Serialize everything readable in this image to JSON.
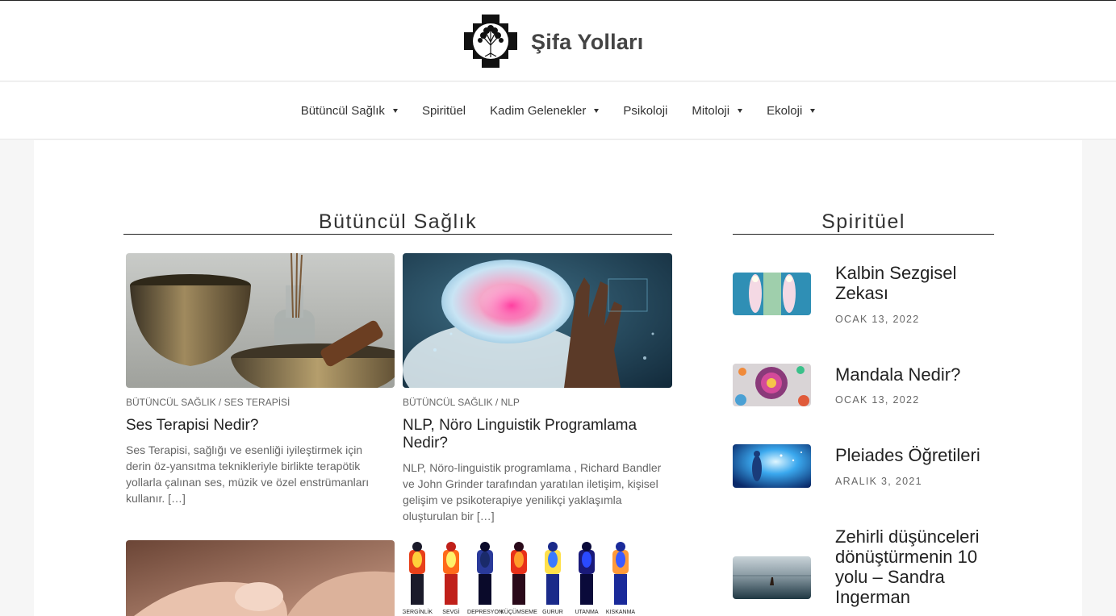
{
  "site": {
    "title": "Şifa Yolları"
  },
  "nav": [
    {
      "label": "Bütüncül Sağlık",
      "has_dropdown": true
    },
    {
      "label": "Spiritüel",
      "has_dropdown": false
    },
    {
      "label": "Kadim Gelenekler",
      "has_dropdown": true
    },
    {
      "label": "Psikoloji",
      "has_dropdown": false
    },
    {
      "label": "Mitoloji",
      "has_dropdown": true
    },
    {
      "label": "Ekoloji",
      "has_dropdown": true
    }
  ],
  "main_section": {
    "title": "Bütüncül Sağlık",
    "posts": [
      {
        "category": "BÜTÜNCÜL SAĞLIK / SES TERAPİSİ",
        "title": "Ses Terapisi Nedir?",
        "excerpt": "Ses Terapisi, sağlığı ve esenliği iyileştirmek için derin öz-yansıtma teknikleriyle birlikte terapötik yollarla çalınan ses, müzik ve özel enstrümanları kullanır. […]"
      },
      {
        "category": "BÜTÜNCÜL SAĞLIK / NLP",
        "title": "NLP, Nöro Linguistik Programlama Nedir?",
        "excerpt": "NLP, Nöro-linguistik programlama , Richard Bandler ve John Grinder tarafından yaratılan iletişim, kişisel gelişim ve psikoterapiye yenilikçi yaklaşımla oluşturulan bir […]"
      }
    ],
    "emotion_labels": [
      "GERGİNLİK",
      "SEVGİ",
      "DEPRESYON",
      "KÜÇÜMSEME",
      "GURUR",
      "UTANMA",
      "KISKANMA"
    ]
  },
  "sidebar": {
    "title": "Spiritüel",
    "posts": [
      {
        "title": "Kalbin Sezgisel Zekası",
        "date": "OCAK 13, 2022"
      },
      {
        "title": "Mandala Nedir?",
        "date": "OCAK 13, 2022"
      },
      {
        "title": "Pleiades Öğretileri",
        "date": "ARALIK 3, 2021"
      },
      {
        "title": "Zehirli düşünceleri dönüştürmenin 10 yolu – Sandra Ingerman",
        "date": ""
      }
    ]
  },
  "colors": {
    "text": "#333333",
    "muted": "#666666",
    "background": "#f6f6f6"
  }
}
